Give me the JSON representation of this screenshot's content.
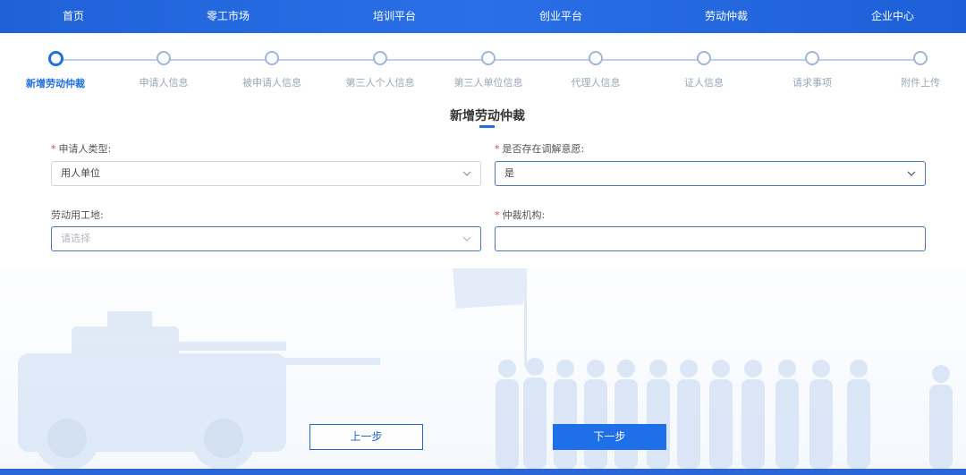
{
  "nav": {
    "items": [
      "首页",
      "零工市场",
      "培训平台",
      "创业平台",
      "劳动仲裁",
      "企业中心"
    ]
  },
  "steps": [
    {
      "label": "新增劳动仲裁",
      "active": true
    },
    {
      "label": "申请人信息",
      "active": false
    },
    {
      "label": "被申请人信息",
      "active": false
    },
    {
      "label": "第三人个人信息",
      "active": false
    },
    {
      "label": "第三人单位信息",
      "active": false
    },
    {
      "label": "代理人信息",
      "active": false
    },
    {
      "label": "证人信息",
      "active": false
    },
    {
      "label": "请求事项",
      "active": false
    },
    {
      "label": "附件上传",
      "active": false
    }
  ],
  "form": {
    "title": "新增劳动仲裁",
    "applicant_type": {
      "label": "申请人类型:",
      "required": true,
      "value": "用人单位"
    },
    "mediation_intent": {
      "label": "是否存在调解意愿:",
      "required": true,
      "value": "是"
    },
    "work_location": {
      "label": "劳动用工地:",
      "required": false,
      "placeholder": "请选择"
    },
    "arbitration_body": {
      "label": "仲裁机构:",
      "required": true,
      "value": ""
    }
  },
  "buttons": {
    "prev": "上一步",
    "next": "下一步"
  },
  "colors": {
    "primary": "#1f6fe0",
    "nav_bg": "#2a6fe6",
    "required": "#e04545"
  }
}
